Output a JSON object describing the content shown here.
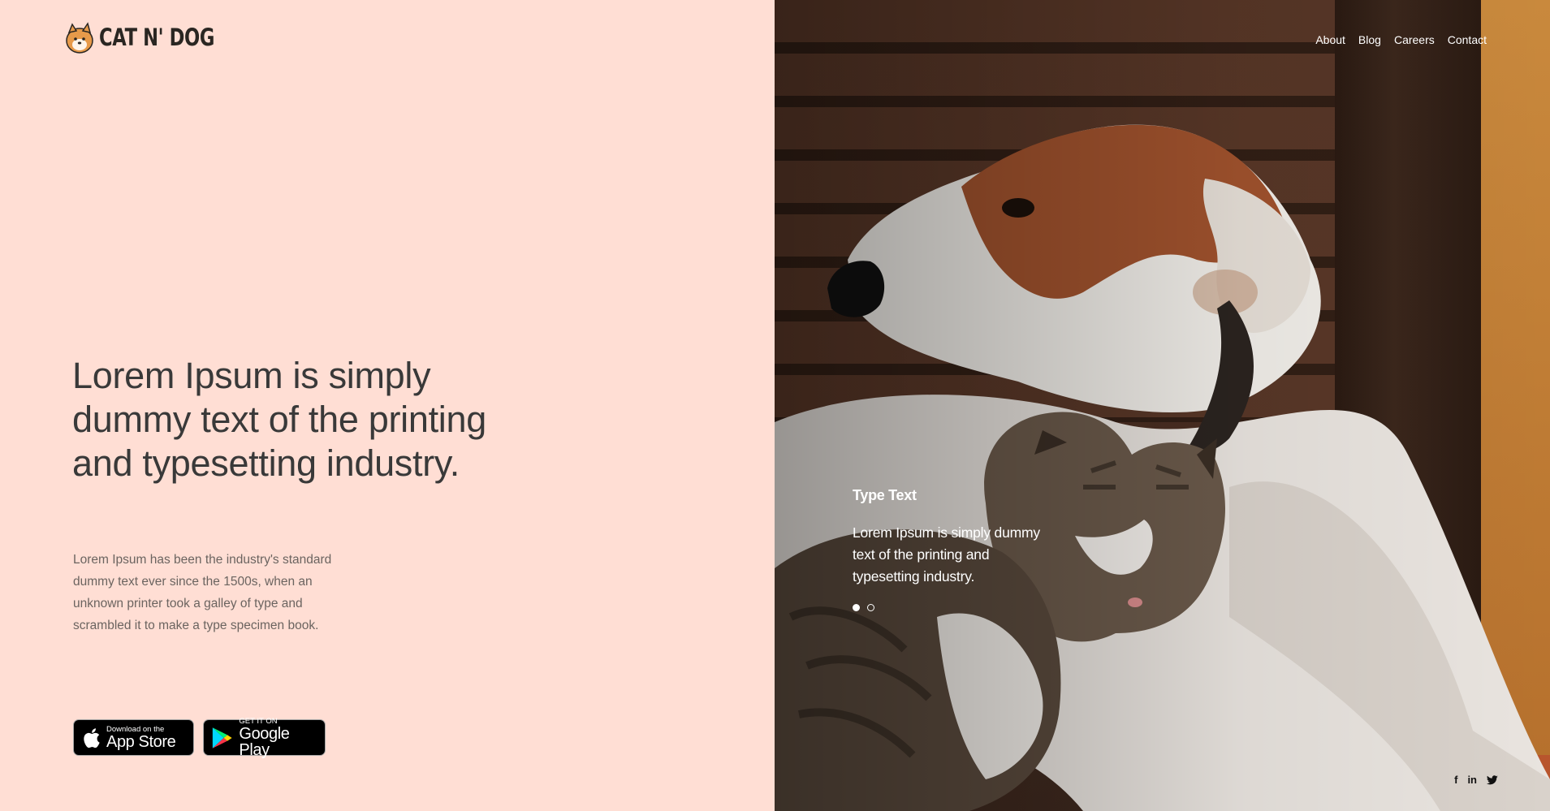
{
  "brand": {
    "name": "CAT N' DOG",
    "logo_icon": "cat-dog-logo-icon"
  },
  "hero": {
    "headline": "Lorem Ipsum is simply dummy text of the printing and typesetting industry.",
    "description": "Lorem Ipsum has been the industry's standard dummy text ever since the 1500s, when an unknown printer took a galley of type and scrambled it to make a type specimen book."
  },
  "stores": {
    "apple": {
      "small": "Download on the",
      "big": "App Store",
      "icon": "apple-icon"
    },
    "google": {
      "small": "GET IT ON",
      "big": "Google Play",
      "icon": "google-play-icon"
    }
  },
  "nav": {
    "items": [
      "About",
      "Blog",
      "Careers",
      "Contact"
    ]
  },
  "slider": {
    "title": "Type Text",
    "text": "Lorem Ipsum is simply dummy text of the printing and typesetting industry.",
    "dots": 2,
    "active_dot": 1
  },
  "social": {
    "facebook": "f",
    "linkedin": "in",
    "twitter": "twitter-icon"
  },
  "colors": {
    "left_bg": "#ffded4",
    "headline": "#393939",
    "body_text": "#6b6460"
  }
}
